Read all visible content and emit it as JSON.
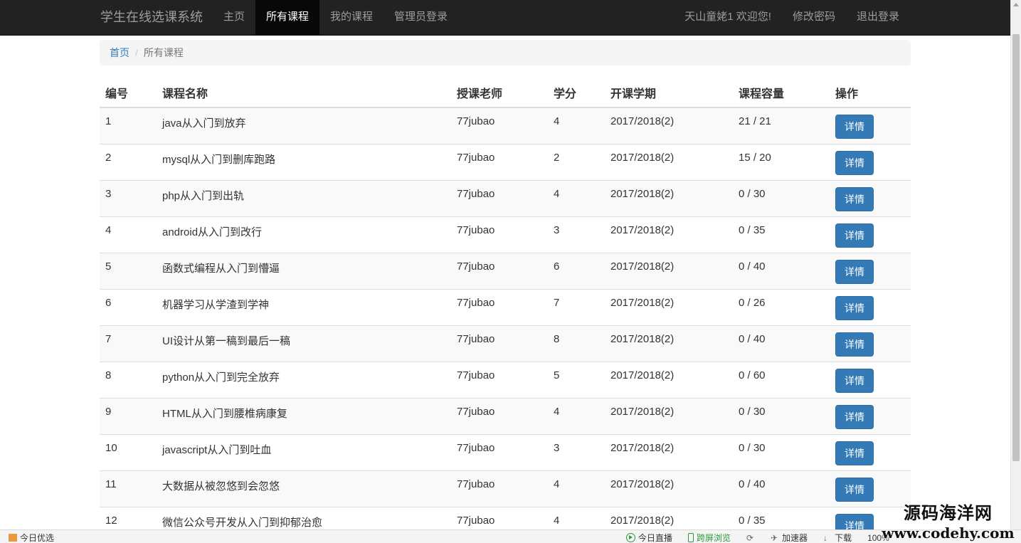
{
  "navbar": {
    "brand": "学生在线选课系统",
    "left_items": [
      {
        "label": "主页",
        "active": false
      },
      {
        "label": "所有课程",
        "active": true
      },
      {
        "label": "我的课程",
        "active": false
      },
      {
        "label": "管理员登录",
        "active": false
      }
    ],
    "welcome": "天山童姥1 欢迎您!",
    "change_password": "修改密码",
    "logout": "退出登录"
  },
  "breadcrumb": {
    "home": "首页",
    "separator": "/",
    "current": "所有课程"
  },
  "table": {
    "headers": [
      "编号",
      "课程名称",
      "授课老师",
      "学分",
      "开课学期",
      "课程容量",
      "操作"
    ],
    "detail_label": "详情",
    "rows": [
      {
        "id": "1",
        "name": "java从入门到放弃",
        "teacher": "77jubao",
        "credit": "4",
        "term": "2017/2018(2)",
        "capacity": "21 / 21"
      },
      {
        "id": "2",
        "name": "mysql从入门到删库跑路",
        "teacher": "77jubao",
        "credit": "2",
        "term": "2017/2018(2)",
        "capacity": "15 / 20"
      },
      {
        "id": "3",
        "name": "php从入门到出轨",
        "teacher": "77jubao",
        "credit": "4",
        "term": "2017/2018(2)",
        "capacity": "0 / 30"
      },
      {
        "id": "4",
        "name": "android从入门到改行",
        "teacher": "77jubao",
        "credit": "3",
        "term": "2017/2018(2)",
        "capacity": "0 / 35"
      },
      {
        "id": "5",
        "name": "函数式编程从入门到懵逼",
        "teacher": "77jubao",
        "credit": "6",
        "term": "2017/2018(2)",
        "capacity": "0 / 40"
      },
      {
        "id": "6",
        "name": "机器学习从学渣到学神",
        "teacher": "77jubao",
        "credit": "7",
        "term": "2017/2018(2)",
        "capacity": "0 / 26"
      },
      {
        "id": "7",
        "name": "UI设计从第一稿到最后一稿",
        "teacher": "77jubao",
        "credit": "8",
        "term": "2017/2018(2)",
        "capacity": "0 / 40"
      },
      {
        "id": "8",
        "name": "python从入门到完全放弃",
        "teacher": "77jubao",
        "credit": "5",
        "term": "2017/2018(2)",
        "capacity": "0 / 60"
      },
      {
        "id": "9",
        "name": "HTML从入门到腰椎病康复",
        "teacher": "77jubao",
        "credit": "4",
        "term": "2017/2018(2)",
        "capacity": "0 / 30"
      },
      {
        "id": "10",
        "name": "javascript从入门到吐血",
        "teacher": "77jubao",
        "credit": "3",
        "term": "2017/2018(2)",
        "capacity": "0 / 30"
      },
      {
        "id": "11",
        "name": "大数据从被忽悠到会忽悠",
        "teacher": "77jubao",
        "credit": "4",
        "term": "2017/2018(2)",
        "capacity": "0 / 40"
      },
      {
        "id": "12",
        "name": "微信公众号开发从入门到抑郁治愈",
        "teacher": "77jubao",
        "credit": "4",
        "term": "2017/2018(2)",
        "capacity": "0 / 35"
      }
    ]
  },
  "statusbar": {
    "left": "今日优选",
    "live": "今日直播",
    "cross_screen": "跨屏浏览",
    "accelerator": "加速器",
    "download": "下载",
    "zoom": "100%"
  },
  "watermark": {
    "name": "源码海洋网",
    "url": "www.codehy.com"
  },
  "colors": {
    "navbar_bg": "#222222",
    "primary": "#337ab7",
    "stripe": "#f9f9f9",
    "status_green": "#2a9a3a"
  }
}
